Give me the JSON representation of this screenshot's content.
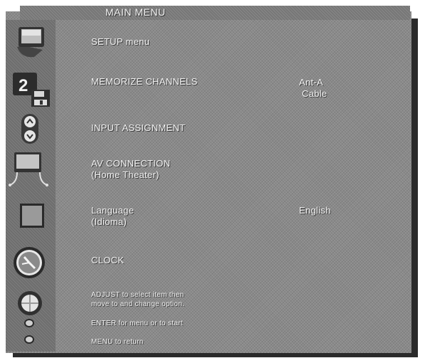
{
  "title": "MAIN MENU",
  "menu": [
    {
      "label": "SETUP menu",
      "icon": "tv-setup-icon"
    },
    {
      "label": "MEMORIZE CHANNELS",
      "value_line1": "Ant-A",
      "value_line2": "Cable",
      "icon": "channel-memory-icon"
    },
    {
      "label": "INPUT ASSIGNMENT",
      "icon": "input-arrows-icon"
    },
    {
      "label_line1": "AV CONNECTION",
      "label_line2": "(Home Theater)",
      "icon": "av-connection-icon"
    },
    {
      "label_line1": "Language",
      "label_line2": "(Idioma)",
      "value": "English",
      "icon": "language-icon"
    },
    {
      "label": "CLOCK",
      "icon": "clock-icon"
    }
  ],
  "help": {
    "line1": "ADJUST to select item then",
    "line2": "move to and change option.",
    "line3": "ENTER for menu or to start",
    "line4": "MENU to return"
  },
  "help_icons": [
    "joystick-icon",
    "enter-button-icon",
    "menu-button-icon"
  ],
  "colors": {
    "panel": "#8a8a8a",
    "text": "#f2f2f2",
    "shadow": "#2a2a2a"
  }
}
